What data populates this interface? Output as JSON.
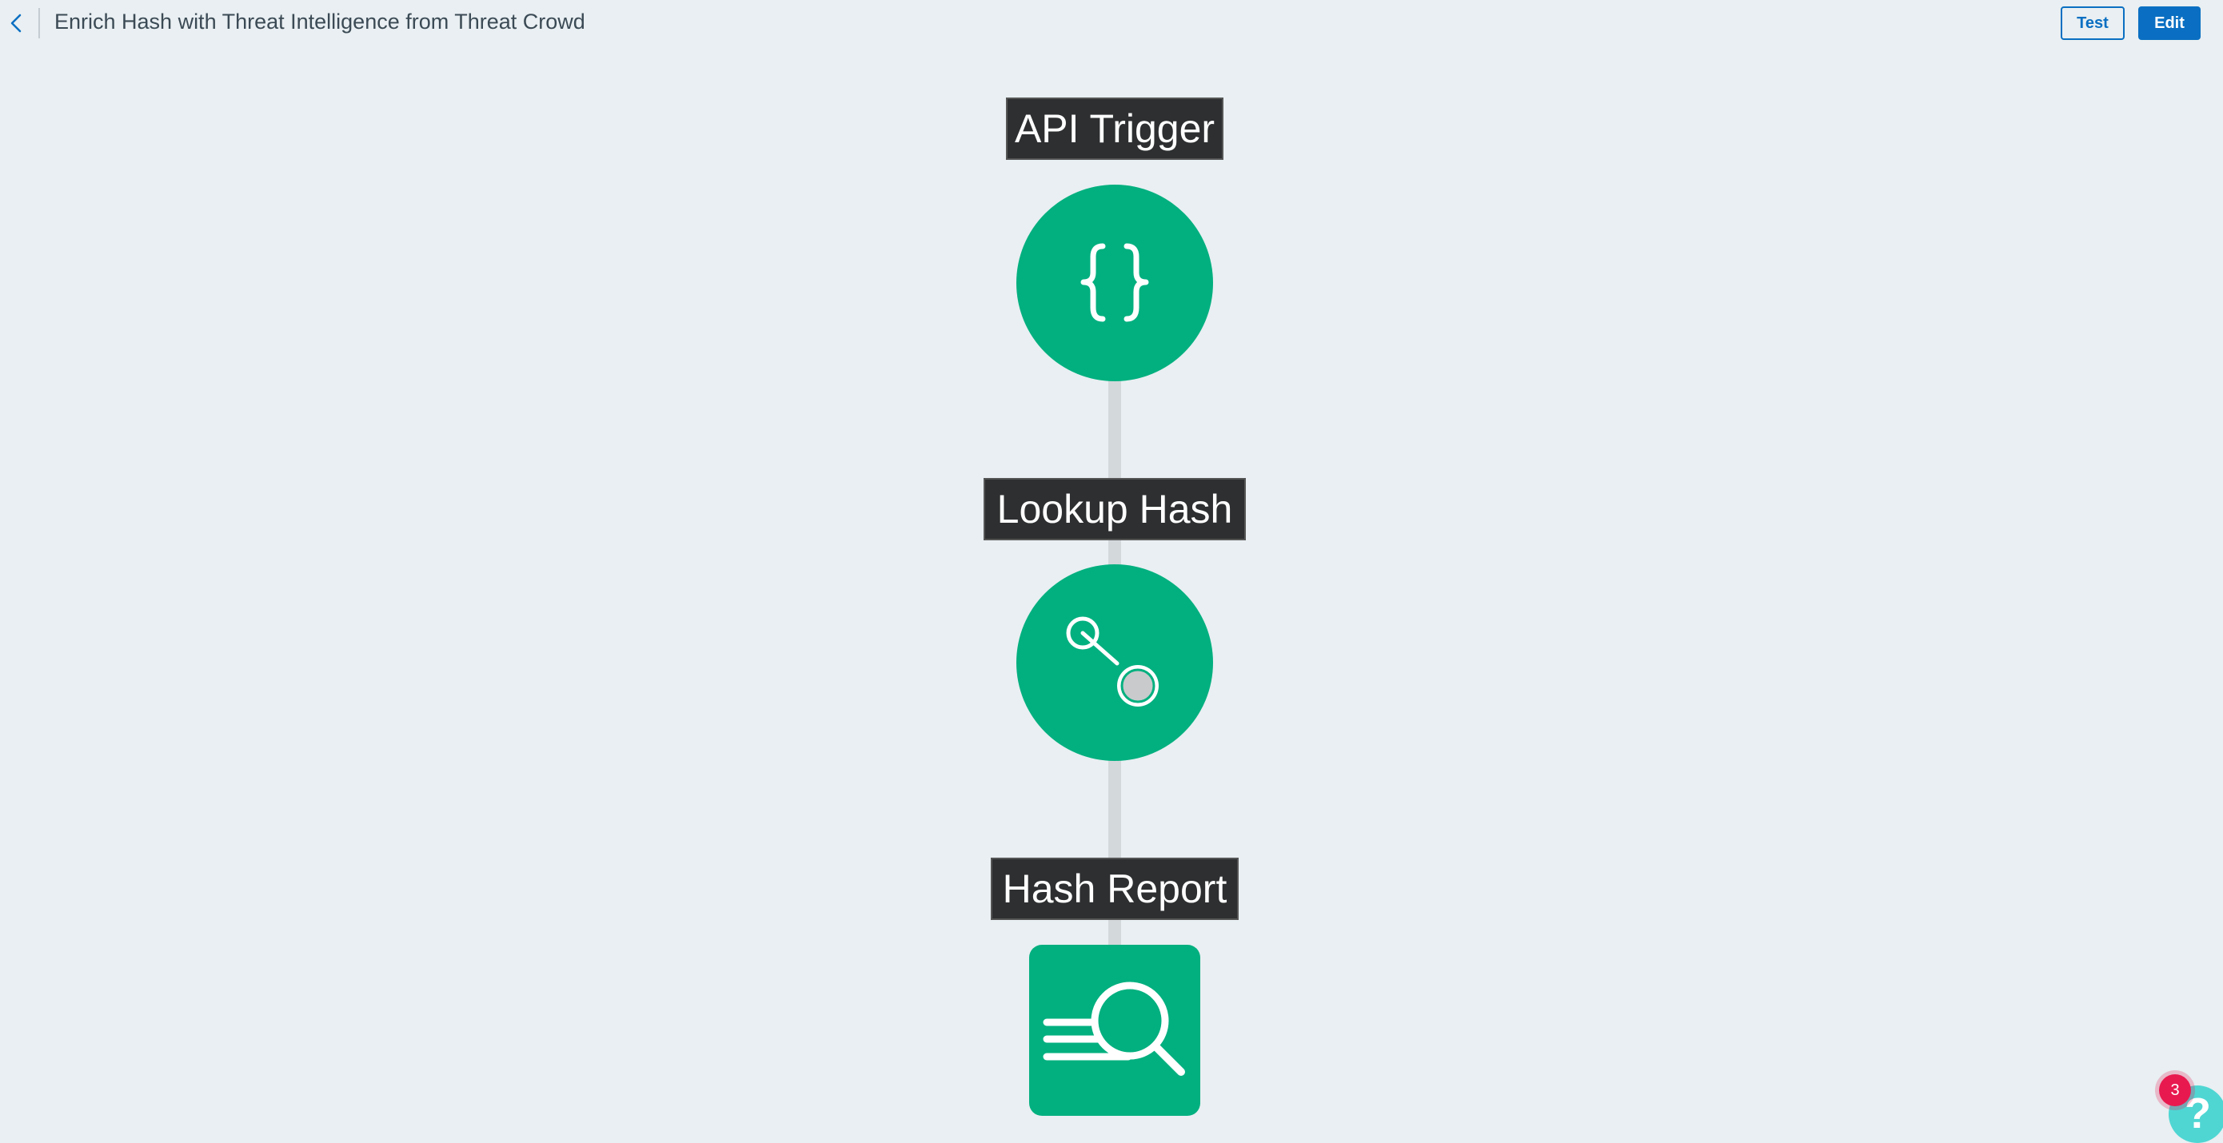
{
  "header": {
    "title": "Enrich Hash with Threat Intelligence from Threat Crowd",
    "back_icon": "chevron-left-icon",
    "test_label": "Test",
    "edit_label": "Edit"
  },
  "workflow": {
    "nodes": [
      {
        "label": "API Trigger",
        "icon": "curly-braces-icon",
        "shape": "circle"
      },
      {
        "label": "Lookup Hash",
        "icon": "lookup-node-icon",
        "shape": "circle"
      },
      {
        "label": "Hash Report",
        "icon": "search-report-icon",
        "shape": "square"
      }
    ]
  },
  "help": {
    "label": "?",
    "badge_count": "3"
  },
  "colors": {
    "background": "#e9eff2",
    "node": "#02b07f",
    "label_bg": "#2d2f30",
    "primary": "#0a6fc2",
    "badge": "#e8194f",
    "help": "#4fd6d3"
  }
}
